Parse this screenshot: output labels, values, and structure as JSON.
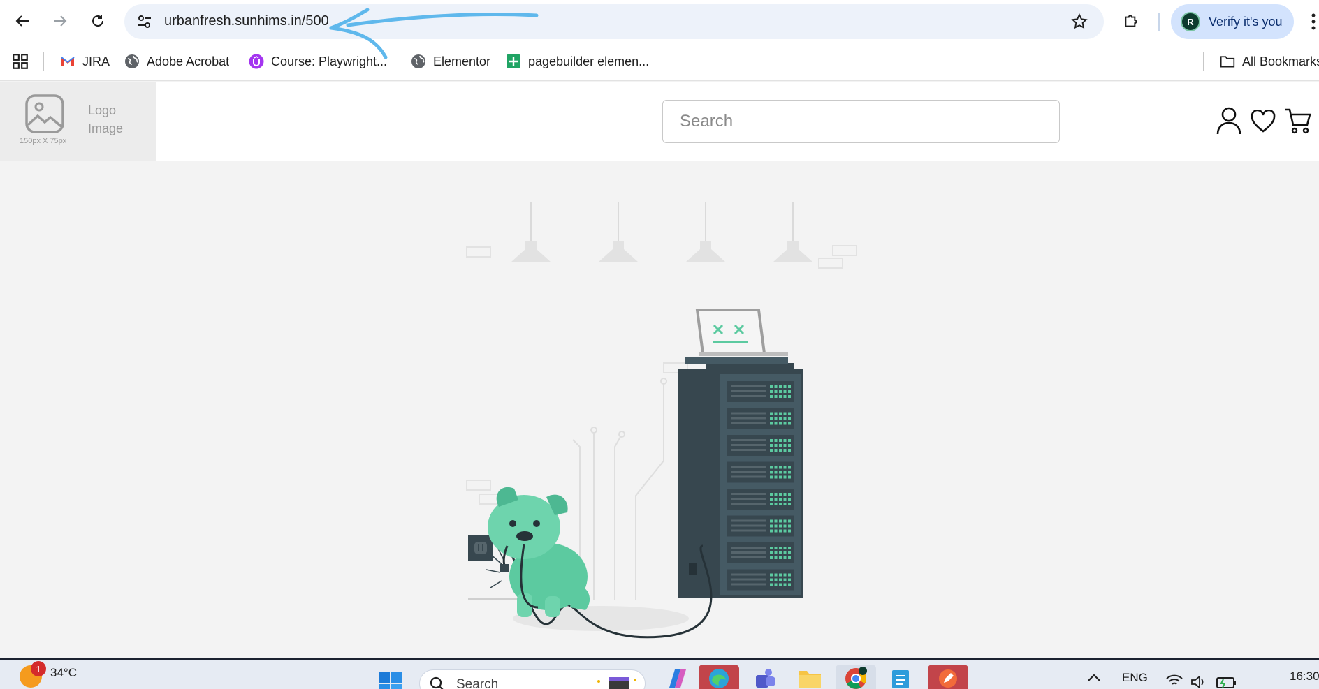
{
  "browser": {
    "url": "urbanfresh.sunhims.in/500",
    "profile_initial": "R",
    "profile_label": "Verify it's you"
  },
  "bookmarks": {
    "items": [
      {
        "label": "JIRA",
        "icon": "gmail-icon"
      },
      {
        "label": "Adobe Acrobat",
        "icon": "globe-icon"
      },
      {
        "label": "Course: Playwright...",
        "icon": "udemy-icon"
      },
      {
        "label": "Elementor",
        "icon": "globe-icon"
      },
      {
        "label": "pagebuilder elemen...",
        "icon": "sheets-icon"
      }
    ],
    "all_label": "All Bookmarks"
  },
  "site": {
    "logo_dim": "150px X 75px",
    "logo_line1": "Logo",
    "logo_line2": "Image",
    "search_placeholder": "Search"
  },
  "illustration": {
    "name": "500 server error – dog unplugging server",
    "colors": {
      "dog": "#5ccaa0",
      "server": "#37474f",
      "screen_mark": "#5ccaa0"
    }
  },
  "taskbar": {
    "weather_temp": "34°C",
    "weather_badge": "1",
    "search_label": "Search",
    "language": "ENG",
    "time": "16:30"
  },
  "colors": {
    "omnibox": "#edf2fa",
    "verify_bg": "#d3e3fd",
    "page_bg": "#f3f3f3",
    "annotation": "#5fb8ec"
  }
}
